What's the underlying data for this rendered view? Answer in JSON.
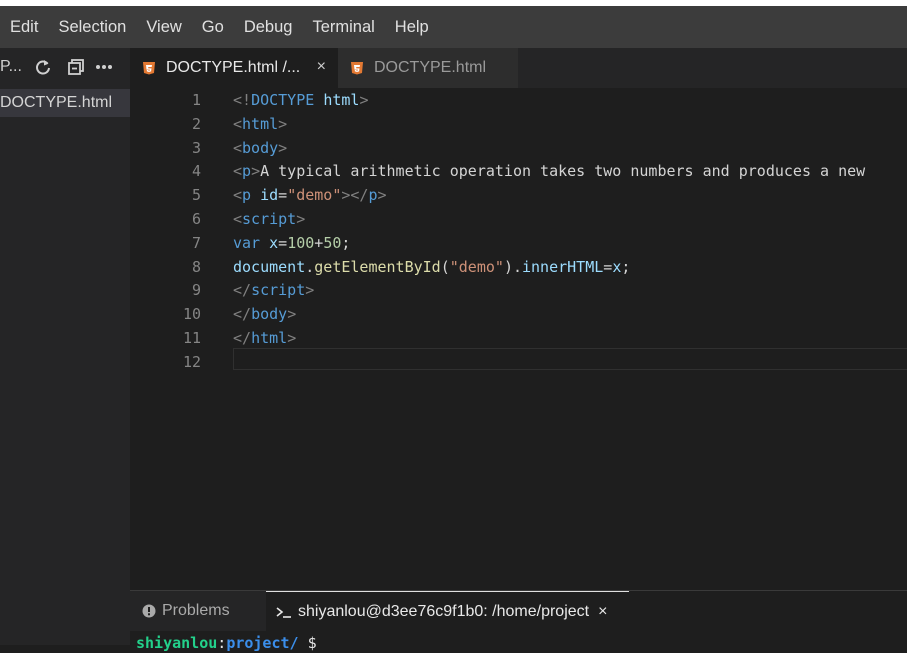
{
  "menubar": {
    "items": [
      "Edit",
      "Selection",
      "View",
      "Go",
      "Debug",
      "Terminal",
      "Help"
    ]
  },
  "sidebar": {
    "title": "P...",
    "icons": [
      "refresh-icon",
      "collapse-all-icon",
      "more-icon"
    ],
    "files": [
      "DOCTYPE.html"
    ]
  },
  "tabs": [
    {
      "label": "DOCTYPE.html /...",
      "active": true,
      "icon": "html5-icon",
      "close": "×"
    },
    {
      "label": "DOCTYPE.html",
      "active": false,
      "icon": "html5-icon"
    }
  ],
  "editor": {
    "lines": [
      {
        "n": "1",
        "tokens": [
          [
            "t-punct",
            "<!"
          ],
          [
            "t-tag",
            "DOCTYPE"
          ],
          [
            "t-text",
            " "
          ],
          [
            "t-attr",
            "html"
          ],
          [
            "t-punct",
            ">"
          ]
        ]
      },
      {
        "n": "2",
        "tokens": [
          [
            "t-punct",
            "<"
          ],
          [
            "t-tag",
            "html"
          ],
          [
            "t-punct",
            ">"
          ]
        ]
      },
      {
        "n": "3",
        "tokens": [
          [
            "t-punct",
            "<"
          ],
          [
            "t-tag",
            "body"
          ],
          [
            "t-punct",
            ">"
          ]
        ]
      },
      {
        "n": "4",
        "tokens": [
          [
            "t-punct",
            "<"
          ],
          [
            "t-tag",
            "p"
          ],
          [
            "t-punct",
            ">"
          ],
          [
            "t-text",
            "A typical arithmetic operation takes two numbers and produces a new"
          ]
        ]
      },
      {
        "n": "5",
        "tokens": [
          [
            "t-punct",
            "<"
          ],
          [
            "t-tag",
            "p"
          ],
          [
            "t-text",
            " "
          ],
          [
            "t-attr",
            "id"
          ],
          [
            "t-text",
            "="
          ],
          [
            "t-str",
            "\"demo\""
          ],
          [
            "t-punct",
            "></"
          ],
          [
            "t-tag",
            "p"
          ],
          [
            "t-punct",
            ">"
          ]
        ]
      },
      {
        "n": "6",
        "tokens": [
          [
            "t-punct",
            "<"
          ],
          [
            "t-tag",
            "script"
          ],
          [
            "t-punct",
            ">"
          ]
        ]
      },
      {
        "n": "7",
        "tokens": [
          [
            "t-tag",
            "var"
          ],
          [
            "t-text",
            " "
          ],
          [
            "t-attr",
            "x"
          ],
          [
            "t-text",
            "="
          ],
          [
            "t-num",
            "100"
          ],
          [
            "t-text",
            "+"
          ],
          [
            "t-num",
            "50"
          ],
          [
            "t-text",
            ";"
          ]
        ]
      },
      {
        "n": "8",
        "tokens": [
          [
            "t-attr",
            "document"
          ],
          [
            "t-text",
            "."
          ],
          [
            "t-fn",
            "getElementById"
          ],
          [
            "t-text",
            "("
          ],
          [
            "t-str",
            "\"demo\""
          ],
          [
            "t-text",
            ")."
          ],
          [
            "t-attr",
            "innerHTML"
          ],
          [
            "t-text",
            "="
          ],
          [
            "t-attr",
            "x"
          ],
          [
            "t-text",
            ";"
          ]
        ]
      },
      {
        "n": "9",
        "tokens": [
          [
            "t-punct",
            "</"
          ],
          [
            "t-tag",
            "script"
          ],
          [
            "t-punct",
            ">"
          ]
        ]
      },
      {
        "n": "10",
        "tokens": [
          [
            "t-punct",
            "</"
          ],
          [
            "t-tag",
            "body"
          ],
          [
            "t-punct",
            ">"
          ]
        ]
      },
      {
        "n": "11",
        "tokens": [
          [
            "t-punct",
            "</"
          ],
          [
            "t-tag",
            "html"
          ],
          [
            "t-punct",
            ">"
          ]
        ]
      },
      {
        "n": "12",
        "tokens": []
      }
    ]
  },
  "panel": {
    "problems_label": "Problems",
    "terminal_label": "shiyanlou@d3ee76c9f1b0: /home/project",
    "terminal_close": "×",
    "terminal_prompt": {
      "user": "shiyanlou",
      "sep": ":",
      "path": "project/",
      "symbol": " $"
    }
  },
  "colors": {
    "accent_html": "#e37933",
    "keyword": "#569cd6",
    "string": "#ce9178",
    "number": "#b5cea8"
  }
}
